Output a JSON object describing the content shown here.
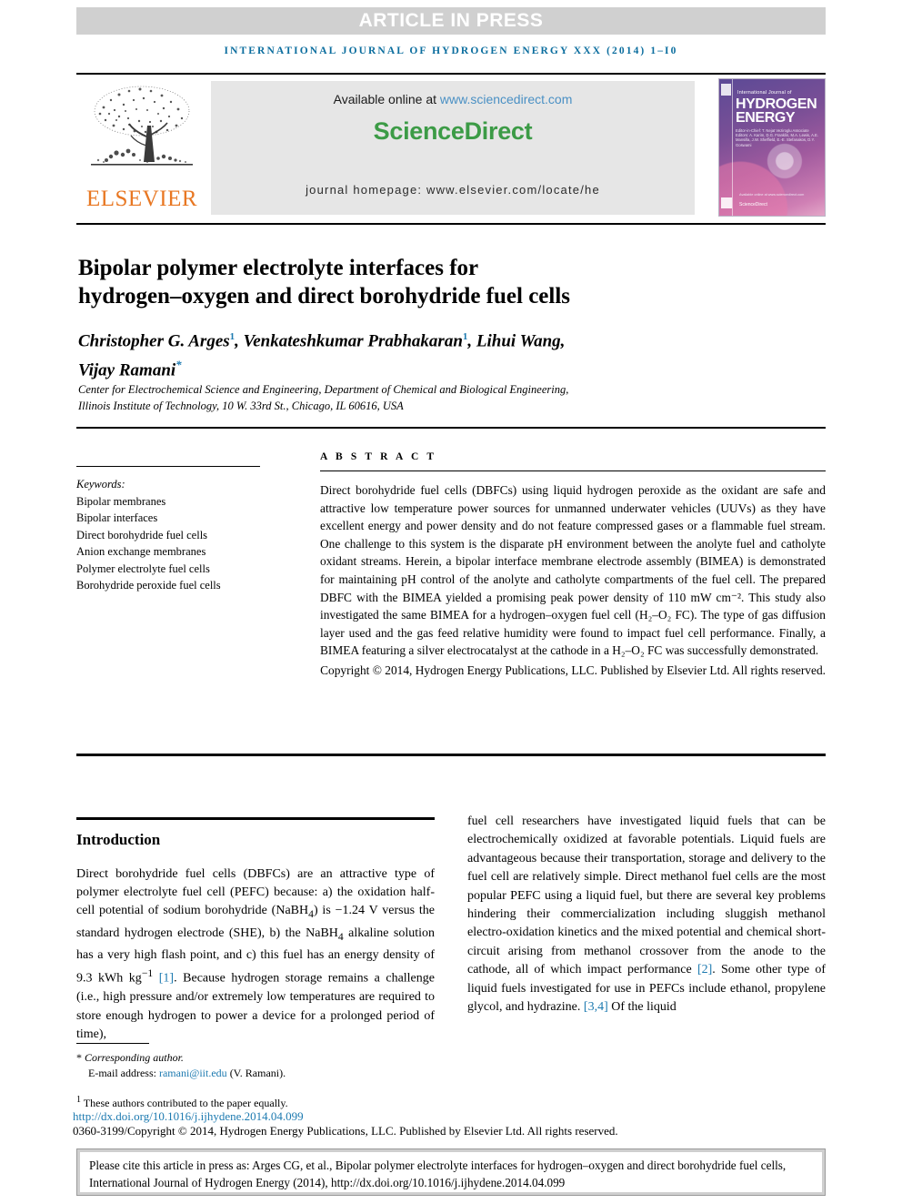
{
  "banner": {
    "label": "ARTICLE IN PRESS",
    "background": "#d0d0d0",
    "text_color": "#ffffff"
  },
  "running_head": {
    "text": "INTERNATIONAL JOURNAL OF HYDROGEN ENERGY XXX (2014) 1–I0",
    "color": "#0b6d9e"
  },
  "masthead": {
    "publisher": "ELSEVIER",
    "publisher_color": "#e87722",
    "available_prefix": "Available online at ",
    "available_url": "www.sciencedirect.com",
    "sciencedirect_logo": "ScienceDirect",
    "sciencedirect_color": "#3c9b46",
    "homepage": "journal homepage: www.elsevier.com/locate/he",
    "cover": {
      "line_small": "International Journal of",
      "line_big_1": "HYDROGEN",
      "line_big_2": "ENERGY",
      "editors": "Editor-in-Chief: T. Nejat Veziroglu\nAssociate Editors: A. Karim, D.G. Franklin, M.A. Lewis, A.E. Mansilla, J.W. Sheffield, E.-E. Stefanakos, D.Y. Goswami",
      "sd_mini": "ScienceDirect",
      "sd_mini_sub": "Available online at www.sciencedirect.com"
    }
  },
  "article": {
    "title_line_1": "Bipolar polymer electrolyte interfaces for",
    "title_line_2": "hydrogen–oxygen and direct borohydride fuel cells",
    "authors_html": "Christopher G. Arges<sup class=\"sup\">1</sup>, Venkateshkumar Prabhakaran<sup class=\"sup\">1</sup>, Lihui Wang,<br>Vijay Ramani<sup class=\"star\">*</sup>",
    "affiliation_line_1": "Center for Electrochemical Science and Engineering, Department of Chemical and Biological Engineering,",
    "affiliation_line_2": "Illinois Institute of Technology, 10 W. 33rd St., Chicago, IL 60616, USA"
  },
  "keywords": {
    "heading": "Keywords:",
    "items": [
      "Bipolar membranes",
      "Bipolar interfaces",
      "Direct borohydride fuel cells",
      "Anion exchange membranes",
      "Polymer electrolyte fuel cells",
      "Borohydride peroxide fuel cells"
    ]
  },
  "abstract": {
    "heading": "A B S T R A C T",
    "body": "Direct borohydride fuel cells (DBFCs) using liquid hydrogen peroxide as the oxidant are safe and attractive low temperature power sources for unmanned underwater vehicles (UUVs) as they have excellent energy and power density and do not feature compressed gases or a flammable fuel stream. One challenge to this system is the disparate pH environment between the anolyte fuel and catholyte oxidant streams. Herein, a bipolar interface membrane electrode assembly (BIMEA) is demonstrated for maintaining pH control of the anolyte and catholyte compartments of the fuel cell. The prepared DBFC with the BIMEA yielded a promising peak power density of 110 mW cm⁻². This study also investigated the same BIMEA for a hydrogen–oxygen fuel cell (H₂–O₂ FC). The type of gas diffusion layer used and the gas feed relative humidity were found to impact fuel cell performance. Finally, a BIMEA featuring a silver electrocatalyst at the cathode in a H₂–O₂ FC was successfully demonstrated.",
    "copyright": "Copyright © 2014, Hydrogen Energy Publications, LLC. Published by Elsevier Ltd. All rights reserved."
  },
  "introduction": {
    "heading": "Introduction",
    "left_column_html": "Direct borohydride fuel cells (DBFCs) are an attractive type of polymer electrolyte fuel cell (PEFC) because: a) the oxidation half-cell potential of sodium borohydride (NaBH<sub>4</sub>) is &minus;1.24 V versus the standard hydrogen electrode (SHE), b) the NaBH<sub>4</sub> alkaline solution has a very high flash point, and c) this fuel has an energy density of 9.3 kWh kg<sup>&minus;1</sup> <span class=\"ref\">[1]</span>. Because hydrogen storage remains a challenge (i.e., high pressure and/or extremely low temperatures are required to store enough hydrogen to power a device for a prolonged period of time),",
    "right_column_html": "fuel cell researchers have investigated liquid fuels that can be electrochemically oxidized at favorable potentials. Liquid fuels are advantageous because their transportation, storage and delivery to the fuel cell are relatively simple. Direct methanol fuel cells are the most popular PEFC using a liquid fuel, but there are several key problems hindering their commercialization including sluggish methanol electro-oxidation kinetics and the mixed potential and chemical short-circuit arising from methanol crossover from the anode to the cathode, all of which impact performance <span class=\"ref\">[2]</span>. Some other type of liquid fuels investigated for use in PEFCs include ethanol, propylene glycol, and hydrazine. <span class=\"ref\">[3,4]</span> Of the liquid"
  },
  "footnotes": {
    "corresponding": "Corresponding author.",
    "email_label": "E-mail address: ",
    "email": "ramani@iit.edu",
    "email_suffix": " (V. Ramani).",
    "equal_contrib": "These authors contributed to the paper equally.",
    "doi": "http://dx.doi.org/10.1016/j.ijhydene.2014.04.099",
    "issn": "0360-3199/Copyright © 2014, Hydrogen Energy Publications, LLC. Published by Elsevier Ltd. All rights reserved."
  },
  "cite_box": {
    "text": "Please cite this article in press as: Arges CG, et al., Bipolar polymer electrolyte interfaces for hydrogen–oxygen and direct borohydride fuel cells, International Journal of Hydrogen Energy (2014), http://dx.doi.org/10.1016/j.ijhydene.2014.04.099"
  }
}
